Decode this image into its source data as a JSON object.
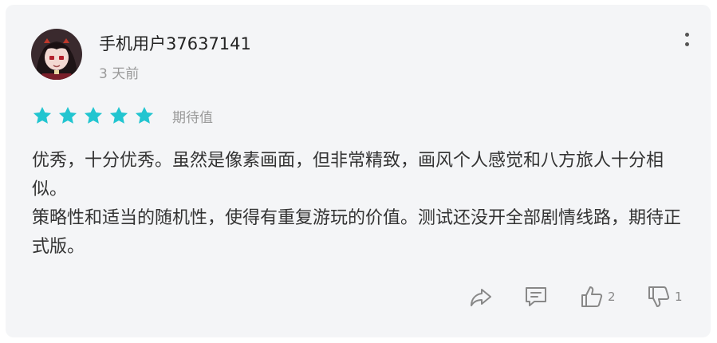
{
  "review": {
    "username": "手机用户37637141",
    "time": "3 天前",
    "rating": 5,
    "tag": "期待值",
    "paragraphs": [
      "优秀，十分优秀。虽然是像素画面，但非常精致，画风个人感觉和八方旅人十分相似。",
      "策略性和适当的随机性，使得有重复游玩的价值。测试还没开全部剧情线路，期待正式版。"
    ],
    "likes": "2",
    "dislikes": "1"
  },
  "colors": {
    "star": "#22c5d0",
    "card": "#f4f5f7",
    "text": "#333333",
    "muted": "#999999",
    "icon": "#888888"
  },
  "icons": [
    "avatar",
    "more-icon",
    "star-icon",
    "share-icon",
    "comment-icon",
    "thumbs-up-icon",
    "thumbs-down-icon"
  ]
}
